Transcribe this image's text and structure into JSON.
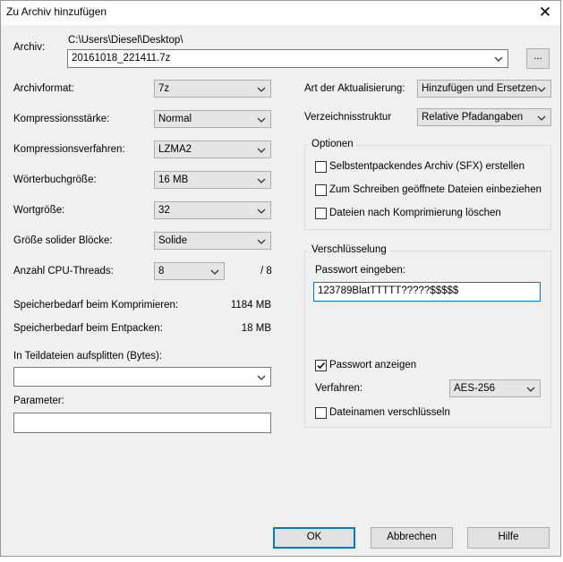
{
  "window": {
    "title": "Zu Archiv hinzufügen",
    "close_glyph": "✕"
  },
  "archive": {
    "label": "Archiv:",
    "path": "C:\\Users\\Diesel\\Desktop\\",
    "filename": "20161018_221411.7z",
    "browse_label": "..."
  },
  "left": {
    "format_label": "Archivformat:",
    "format_value": "7z",
    "level_label": "Kompressionsstärke:",
    "level_value": "Normal",
    "method_label": "Kompressionsverfahren:",
    "method_value": "LZMA2",
    "dict_label": "Wörterbuchgröße:",
    "dict_value": "16 MB",
    "word_label": "Wortgröße:",
    "word_value": "32",
    "solid_label": "Größe solider Blöcke:",
    "solid_value": "Solide",
    "threads_label": "Anzahl CPU-Threads:",
    "threads_value": "8",
    "threads_total": "/ 8",
    "mem_compress_label": "Speicherbedarf beim Komprimieren:",
    "mem_compress_value": "1184 MB",
    "mem_extract_label": "Speicherbedarf beim Entpacken:",
    "mem_extract_value": "18 MB",
    "split_label": "In Teildateien aufsplitten (Bytes):",
    "split_value": "",
    "params_label": "Parameter:",
    "params_value": ""
  },
  "right": {
    "update_label": "Art der Aktualisierung:",
    "update_value": "Hinzufügen und Ersetzen",
    "paths_label": "Verzeichnisstruktur",
    "paths_value": "Relative Pfadangaben",
    "options": {
      "title": "Optionen",
      "sfx_label": "Selbstentpackendes Archiv (SFX) erstellen",
      "sfx_checked": false,
      "shared_label": "Zum Schreiben geöffnete Dateien einbeziehen",
      "shared_checked": false,
      "delete_label": "Dateien nach Komprimierung löschen",
      "delete_checked": false
    },
    "encryption": {
      "title": "Verschlüsselung",
      "password_label": "Passwort eingeben:",
      "password_value": "123789BlatTTTTT?????$$$$$",
      "show_label": "Passwort anzeigen",
      "show_checked": true,
      "method_label": "Verfahren:",
      "method_value": "AES-256",
      "names_label": "Dateinamen verschlüsseln",
      "names_checked": false
    }
  },
  "buttons": {
    "ok": "OK",
    "cancel": "Abbrechen",
    "help": "Hilfe"
  },
  "icons": {
    "dropdown": "chevron-down-icon",
    "check": "check-icon",
    "close": "close-icon"
  },
  "colors": {
    "focus": "#0078d7",
    "dialog_bg": "#f0f0f0"
  }
}
